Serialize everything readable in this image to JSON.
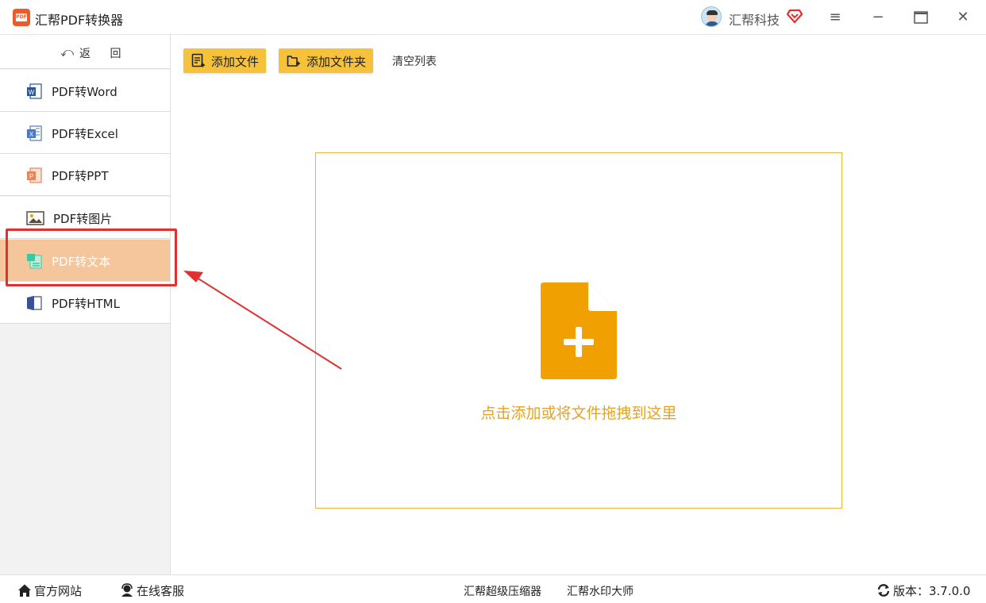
{
  "titlebar": {
    "app_title": "汇帮PDF转换器",
    "company": "汇帮科技",
    "menu_glyph": "≡",
    "minimize_glyph": "−",
    "maximize_glyph": "□",
    "close_glyph": "✕"
  },
  "sidebar": {
    "back_label": "返 回",
    "items": [
      {
        "label": "PDF转Word",
        "icon": "word-icon",
        "color": "#2b579a"
      },
      {
        "label": "PDF转Excel",
        "icon": "excel-icon",
        "color": "#4a78c2"
      },
      {
        "label": "PDF转PPT",
        "icon": "ppt-icon",
        "color": "#e8835a"
      },
      {
        "label": "PDF转图片",
        "icon": "image-icon",
        "color": "#5a4a3a"
      },
      {
        "label": "PDF转文本",
        "icon": "text-icon",
        "color": "#3ac9a0",
        "active": true
      },
      {
        "label": "PDF转HTML",
        "icon": "html-icon",
        "color": "#3b4f9a"
      }
    ]
  },
  "toolbar": {
    "add_file": "添加文件",
    "add_folder": "添加文件夹",
    "clear_list": "清空列表"
  },
  "dropzone": {
    "hint": "点击添加或将文件拖拽到这里",
    "accent": "#f0a000"
  },
  "footer": {
    "website": "官方网站",
    "support": "在线客服",
    "compressor": "汇帮超级压缩器",
    "watermark": "汇帮水印大师",
    "version": "版本：3.7.0.0"
  },
  "colors": {
    "active_item_bg": "#f5c59c",
    "button_bg": "#f7c23b",
    "highlight": "#e03131"
  }
}
